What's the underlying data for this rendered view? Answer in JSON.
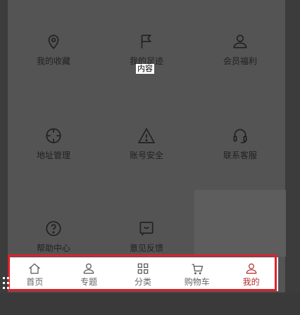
{
  "grid": {
    "items": [
      {
        "label": "我的收藏",
        "icon": "location-pin-icon"
      },
      {
        "label": "我的足迹",
        "icon": "flag-icon"
      },
      {
        "label": "会员福利",
        "icon": "user-icon"
      },
      {
        "label": "地址管理",
        "icon": "crosshair-icon"
      },
      {
        "label": "账号安全",
        "icon": "warning-icon"
      },
      {
        "label": "联系客服",
        "icon": "headset-icon"
      },
      {
        "label": "帮助中心",
        "icon": "question-icon"
      },
      {
        "label": "意见反馈",
        "icon": "feedback-icon"
      }
    ]
  },
  "tooltip": {
    "text": "内容"
  },
  "tabbar": {
    "tabs": [
      {
        "label": "首页",
        "icon": "home-icon",
        "active": false
      },
      {
        "label": "专题",
        "icon": "user-icon",
        "active": false
      },
      {
        "label": "分类",
        "icon": "grid-icon",
        "active": false
      },
      {
        "label": "购物车",
        "icon": "cart-icon",
        "active": false
      },
      {
        "label": "我的",
        "icon": "user-icon",
        "active": true
      }
    ]
  },
  "colors": {
    "active": "#b42c2c",
    "highlight": "#e0202c",
    "overlay": "#545454"
  }
}
